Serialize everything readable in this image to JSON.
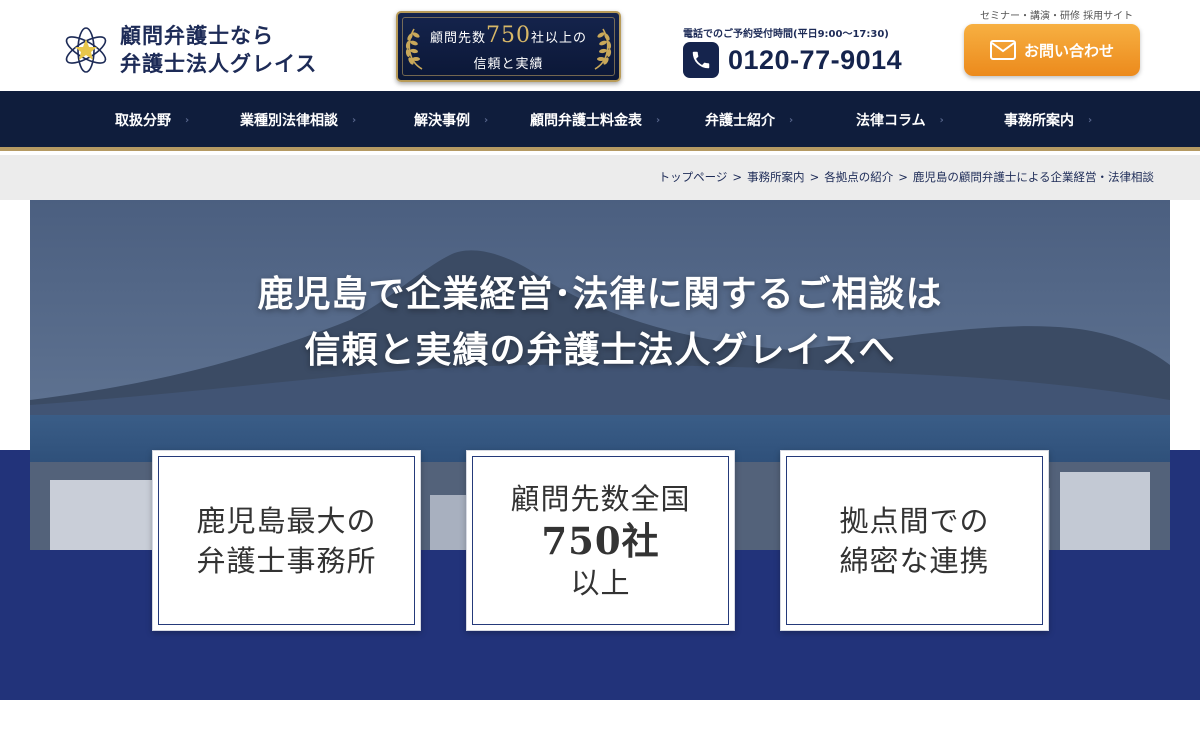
{
  "header": {
    "logo_line1": "顧問弁護士なら",
    "logo_line2": "弁護士法人グレイス",
    "badge": {
      "prefix": "顧問先数",
      "number": "750",
      "suffix": "社以上の",
      "line2": "信頼と実績"
    },
    "phone_caption": "電話でのご予約受付時間(平日9:00～17:30)",
    "phone_number": "0120-77-9014",
    "recruit_link": "セミナー・講演・研修 採用サイト",
    "contact_label": "お問い合わせ"
  },
  "nav": {
    "items": [
      {
        "label": "取扱分野"
      },
      {
        "label": "業種別法律相談"
      },
      {
        "label": "解決事例"
      },
      {
        "label": "顧問弁護士料金表"
      },
      {
        "label": "弁護士紹介"
      },
      {
        "label": "法律コラム"
      },
      {
        "label": "事務所案内"
      }
    ]
  },
  "breadcrumb": {
    "items": [
      "トップページ",
      "事務所案内",
      "各拠点の紹介",
      "鹿児島の顧問弁護士による企業経営・法律相談"
    ]
  },
  "hero": {
    "line1": "鹿児島で企業経営･法律に関するご相談は",
    "line2": "信頼と実績の弁護士法人グレイスへ"
  },
  "features": [
    {
      "line1": "鹿児島最大の",
      "line2": "弁護士事務所"
    },
    {
      "line1": "顧問先数全国",
      "big": "750社",
      "line3": "以上"
    },
    {
      "line1": "拠点間での",
      "line2": "綿密な連携"
    }
  ],
  "colors": {
    "navy": "#0f1d3c",
    "band": "#22337a",
    "gold": "#b59a63",
    "orange": "#ec8a1c"
  },
  "icons": [
    "logo-star-icon",
    "laurel-icon",
    "phone-icon",
    "mail-icon",
    "chevron-right-icon"
  ]
}
